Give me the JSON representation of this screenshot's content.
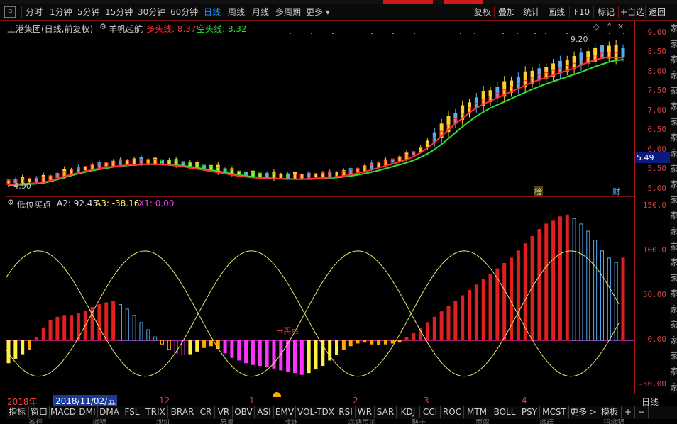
{
  "toolbar": {
    "periods": [
      "分时",
      "1分钟",
      "5分钟",
      "15分钟",
      "30分钟",
      "60分钟",
      "日线",
      "周线",
      "月线",
      "多周期",
      "更多 ▾"
    ],
    "active_period": "日线",
    "right_tools": [
      "复权",
      "叠加",
      "统计",
      "画线",
      "F10",
      "标记",
      "+自选",
      "返回"
    ]
  },
  "main_chart": {
    "title": "上港集团(日线,前复权)",
    "indicator_name": "羊帆起航",
    "long_label": "多头线: 8.37",
    "short_label": "空头线: 8.32",
    "long_color": "#ff3030",
    "short_color": "#30e030",
    "high_label": "9.20",
    "low_label": "4.90",
    "current_price": "5.49",
    "yaxis": [
      "9.00",
      "8.50",
      "8.00",
      "7.50",
      "7.00",
      "6.50",
      "6.00",
      "5.50",
      "5.00"
    ],
    "marker_bang": "榜",
    "marker_cai": "财"
  },
  "sub_chart": {
    "title": "低位买点",
    "a2_label": "A2: 92.43",
    "a3_label": "A3: -38.16",
    "x1_label": "X1: 0.00",
    "yaxis": [
      "150.0",
      "100.0",
      "50.00",
      "0.00",
      "-50.00"
    ],
    "buy_label": "→买点"
  },
  "dates": {
    "year": "2018年",
    "cursor_date": "2018/11/02/五",
    "months": [
      "12",
      "1",
      "2",
      "3",
      "4"
    ],
    "period_label": "日线"
  },
  "indicator_tabs": [
    "指标",
    "窗口",
    "MACD",
    "DMI",
    "DMA",
    "FSL",
    "TRIX",
    "BRAR",
    "CR",
    "VR",
    "OBV",
    "ASI",
    "EMV",
    "VOL-TDX",
    "RSI",
    "WR",
    "SAR",
    "KDJ",
    "CCI",
    "ROC",
    "MTM",
    "BOLL",
    "PSY",
    "MCST",
    "更多 >",
    "模板",
    "+",
    "−"
  ],
  "chart_data": [
    {
      "type": "line",
      "title": "",
      "series": [
        {
          "name": "多头线",
          "values": [
            5.12,
            5.13,
            5.14,
            5.15,
            5.16,
            5.18,
            5.22,
            5.27,
            5.33,
            5.38,
            5.42,
            5.46,
            5.5,
            5.53,
            5.56,
            5.58,
            5.6,
            5.62,
            5.63,
            5.64,
            5.64,
            5.64,
            5.63,
            5.62,
            5.6,
            5.58,
            5.55,
            5.52,
            5.49,
            5.46,
            5.43,
            5.4,
            5.37,
            5.34,
            5.32,
            5.3,
            5.29,
            5.28,
            5.27,
            5.27,
            5.26,
            5.26,
            5.26,
            5.27,
            5.28,
            5.29,
            5.3,
            5.32,
            5.34,
            5.37,
            5.41,
            5.45,
            5.5,
            5.55,
            5.6,
            5.65,
            5.7,
            5.76,
            5.84,
            5.94,
            6.06,
            6.2,
            6.36,
            6.52,
            6.68,
            6.82,
            6.96,
            7.08,
            7.18,
            7.26,
            7.34,
            7.42,
            7.5,
            7.58,
            7.66,
            7.74,
            7.8,
            7.86,
            7.92,
            7.98,
            8.04,
            8.1,
            8.18,
            8.25,
            8.31,
            8.36,
            8.38,
            8.37,
            8.37
          ]
        },
        {
          "name": "空头线",
          "values": [
            5.1,
            5.11,
            5.12,
            5.13,
            5.14,
            5.16,
            5.2,
            5.25,
            5.3,
            5.35,
            5.4,
            5.44,
            5.48,
            5.51,
            5.54,
            5.57,
            5.59,
            5.61,
            5.62,
            5.63,
            5.64,
            5.64,
            5.64,
            5.63,
            5.62,
            5.6,
            5.58,
            5.55,
            5.52,
            5.49,
            5.46,
            5.43,
            5.4,
            5.37,
            5.34,
            5.32,
            5.3,
            5.29,
            5.28,
            5.27,
            5.27,
            5.26,
            5.26,
            5.26,
            5.27,
            5.28,
            5.29,
            5.3,
            5.32,
            5.34,
            5.37,
            5.4,
            5.44,
            5.48,
            5.53,
            5.58,
            5.63,
            5.68,
            5.74,
            5.82,
            5.91,
            6.02,
            6.15,
            6.3,
            6.45,
            6.6,
            6.74,
            6.87,
            6.98,
            7.08,
            7.16,
            7.24,
            7.32,
            7.4,
            7.48,
            7.56,
            7.63,
            7.7,
            7.76,
            7.82,
            7.88,
            7.94,
            8.0,
            8.07,
            8.14,
            8.2,
            8.26,
            8.3,
            8.32
          ]
        }
      ],
      "ylim": [
        4.8,
        9.3
      ]
    },
    {
      "type": "bar",
      "title": "",
      "series": [
        {
          "name": "A2",
          "values": [
            -25,
            -20,
            -15,
            -10,
            3,
            14,
            22,
            26,
            28,
            28,
            30,
            33,
            37,
            40,
            42,
            44,
            40,
            35,
            28,
            20,
            12,
            4,
            -4,
            -10,
            -14,
            -16,
            -15,
            -12,
            -8,
            -6,
            -9,
            -14,
            -19,
            -22,
            -25,
            -27,
            -28,
            -29,
            -31,
            -33,
            -35,
            -36,
            -38,
            -36,
            -32,
            -28,
            -22,
            -16,
            -10,
            -6,
            -3,
            -2,
            -4,
            -5,
            -4,
            -3,
            -2,
            3,
            8,
            14,
            20,
            26,
            32,
            38,
            44,
            50,
            56,
            62,
            68,
            74,
            80,
            86,
            92,
            100,
            108,
            116,
            124,
            130,
            134,
            138,
            140,
            136,
            130,
            122,
            112,
            100,
            92,
            87,
            92
          ]
        },
        {
          "name": "A3",
          "values": [
            -28,
            -30,
            -32,
            -35,
            -37,
            -38,
            -38,
            -37,
            -36,
            -34,
            -32,
            -30,
            -27,
            -24,
            -20,
            -16,
            -12,
            -8,
            -4,
            0,
            4,
            8,
            12,
            16,
            20,
            24,
            28,
            31,
            33,
            35,
            37,
            38,
            38,
            37,
            36,
            34,
            32,
            29,
            26,
            22,
            18,
            14,
            10,
            6,
            2,
            -2,
            -6,
            -10,
            -14,
            -18,
            -22,
            -26,
            -29,
            -32,
            -34,
            -36,
            -37,
            -38,
            -38,
            -37,
            -35,
            -33,
            -30,
            -27,
            -23,
            -19,
            -15,
            -11,
            -7,
            -3,
            1,
            5,
            9,
            13,
            17,
            21,
            25,
            29,
            32,
            34,
            36,
            37,
            38,
            37,
            35,
            32,
            28,
            24,
            20
          ]
        }
      ],
      "ylim": [
        -60,
        160
      ]
    }
  ]
}
